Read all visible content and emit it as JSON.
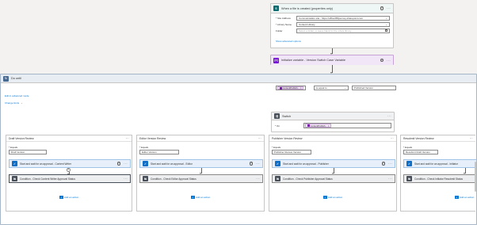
{
  "trigger": {
    "title": "When a file is created (properties only)",
    "fields": [
      {
        "label": "* Site Address",
        "value": "Communication site - https://office365journey.sharepoint.com",
        "kind": "dropdown"
      },
      {
        "label": "* Library Name",
        "value": "Content Library",
        "kind": "dropdown"
      },
      {
        "label": "Folder",
        "value": "Select a folder, or leave blank for the whole library",
        "kind": "folder"
      }
    ],
    "advanced_link": "Show advanced options"
  },
  "init_variable": {
    "title": "Initialize variable - Version Switch Case Variable"
  },
  "do_until": {
    "title": "Do until",
    "token": "ContentPublish...",
    "operator": "is equal to",
    "value": "Published Version",
    "advanced_mode": "Edit in advanced mode",
    "change_limits": "Change limits"
  },
  "switch": {
    "title": "Switch",
    "on_label": "* On",
    "token": "ContentPublish..."
  },
  "branches": [
    {
      "title": "Draft Version Review",
      "equals_label": "* Equals",
      "equals": "Draft Version",
      "approval": "Start and wait for an approval - Content Writer",
      "condition": "Condition - Check Content Writer Approval Status",
      "add_action": "Add an action"
    },
    {
      "title": "Editor Version Review",
      "equals_label": "* Equals",
      "equals": "Editor Version",
      "approval": "Start and wait for an approval - Editor",
      "condition": "Condition - Check Editor Approval Status",
      "add_action": "Add an action"
    },
    {
      "title": "Publisher Version Review",
      "equals_label": "* Equals",
      "equals": "Publisher Review Version",
      "approval": "Start and wait for an approval - Publisher",
      "condition": "Condition - Check Publisher Approval Status",
      "add_action": "Add an action"
    },
    {
      "title": "Resubmit Version Review",
      "equals_label": "* Equals",
      "equals": "Resubmit Draft Version",
      "approval": "Start and wait for an approval - Initiator",
      "condition": "Condition - Check Initiator Resubmit Status",
      "add_action": "Add an action"
    }
  ],
  "icons": {
    "more": "···",
    "help": "?",
    "close": "×",
    "chevron": "⌄",
    "plus": "+"
  },
  "colors": {
    "sharepoint": "#036c70",
    "variable": "#770bd6",
    "loop": "#486991",
    "approval": "#0f6fc6",
    "condition": "#484f58",
    "switch": "#484f58",
    "link": "#0078d4"
  }
}
